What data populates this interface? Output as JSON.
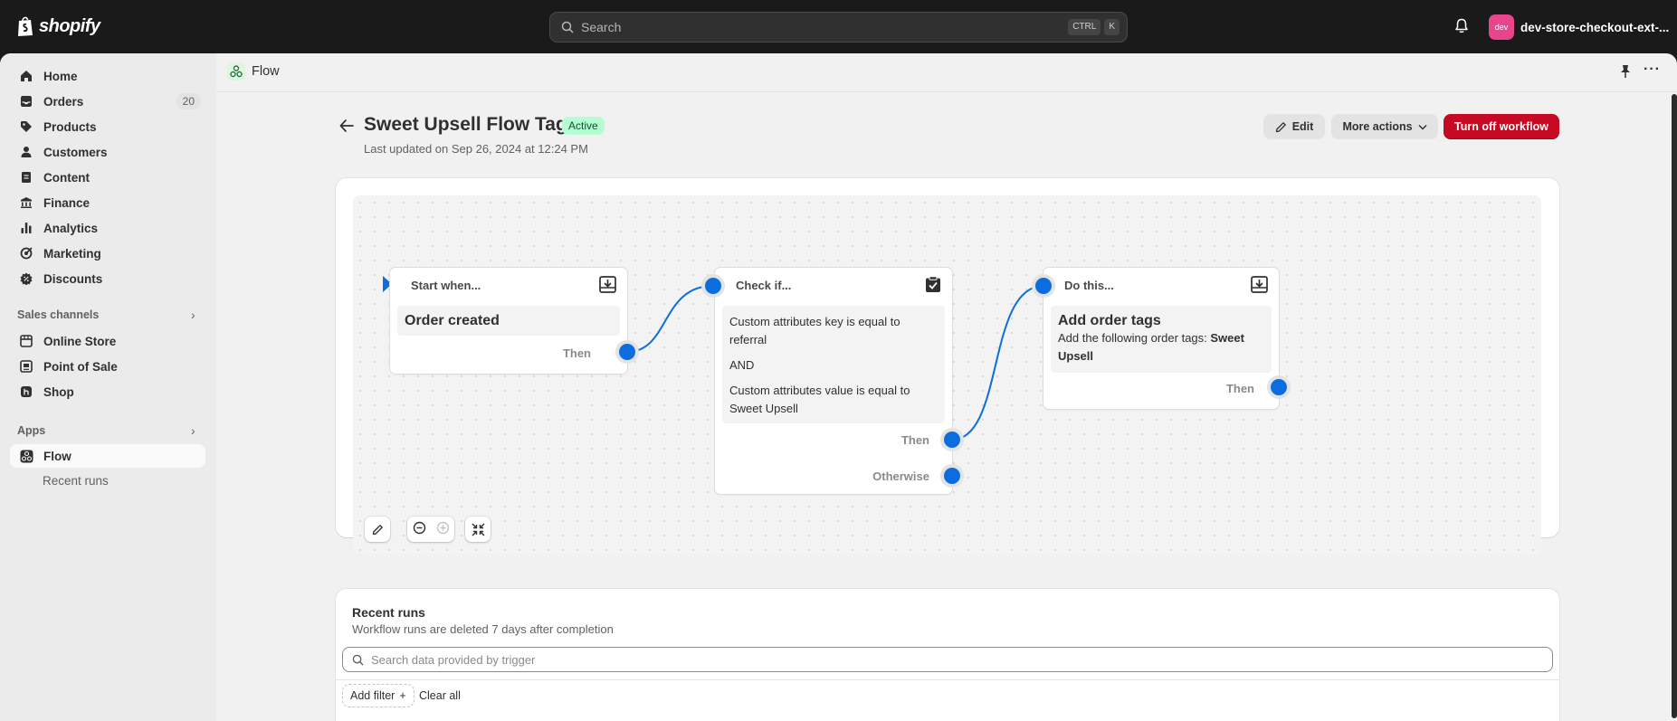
{
  "topbar": {
    "logo_text": "shopify",
    "search_placeholder": "Search",
    "shortcut_ctrl": "CTRL",
    "shortcut_k": "K",
    "store_avatar": "dev",
    "store_name": "dev-store-checkout-ext-..."
  },
  "sidebar": {
    "items": [
      {
        "label": "Home",
        "icon": "home-icon"
      },
      {
        "label": "Orders",
        "icon": "inbox-icon",
        "count": "20"
      },
      {
        "label": "Products",
        "icon": "tag-icon"
      },
      {
        "label": "Customers",
        "icon": "person-icon"
      },
      {
        "label": "Content",
        "icon": "document-icon"
      },
      {
        "label": "Finance",
        "icon": "bank-icon"
      },
      {
        "label": "Analytics",
        "icon": "bar-chart-icon"
      },
      {
        "label": "Marketing",
        "icon": "target-icon"
      },
      {
        "label": "Discounts",
        "icon": "discount-icon"
      }
    ],
    "sales_channels_label": "Sales channels",
    "sales_channels": [
      {
        "label": "Online Store",
        "icon": "storefront-icon"
      },
      {
        "label": "Point of Sale",
        "icon": "pos-icon"
      },
      {
        "label": "Shop",
        "icon": "shop-icon"
      }
    ],
    "apps_label": "Apps",
    "apps": [
      {
        "label": "Flow",
        "icon": "flow-icon"
      }
    ],
    "apps_sub": [
      {
        "label": "Recent runs"
      }
    ]
  },
  "app_header": {
    "title": "Flow"
  },
  "page": {
    "title": "Sweet Upsell Flow Tag",
    "status": "Active",
    "updated": "Last updated on Sep 26, 2024 at 12:24 PM",
    "edit_label": "Edit",
    "more_actions_label": "More actions",
    "turn_off_label": "Turn off workflow"
  },
  "workflow": {
    "trigger": {
      "head": "Start when...",
      "title": "Order created",
      "then": "Then"
    },
    "condition": {
      "head": "Check if...",
      "line1": "Custom attributes key is equal to referral",
      "and": "AND",
      "line2": "Custom attributes value is equal to Sweet Upsell",
      "then": "Then",
      "otherwise": "Otherwise"
    },
    "action": {
      "head": "Do this...",
      "title": "Add order tags",
      "text_prefix": "Add the following order tags: ",
      "text_bold": "Sweet Upsell",
      "then": "Then"
    }
  },
  "recent_runs": {
    "title": "Recent runs",
    "subtitle": "Workflow runs are deleted 7 days after completion",
    "search_placeholder": "Search data provided by trigger",
    "add_filter": "Add filter",
    "clear_all": "Clear all"
  },
  "colors": {
    "primary_blue": "#0c6ede",
    "danger": "#c70a24",
    "success_bg": "#b4fed2"
  }
}
